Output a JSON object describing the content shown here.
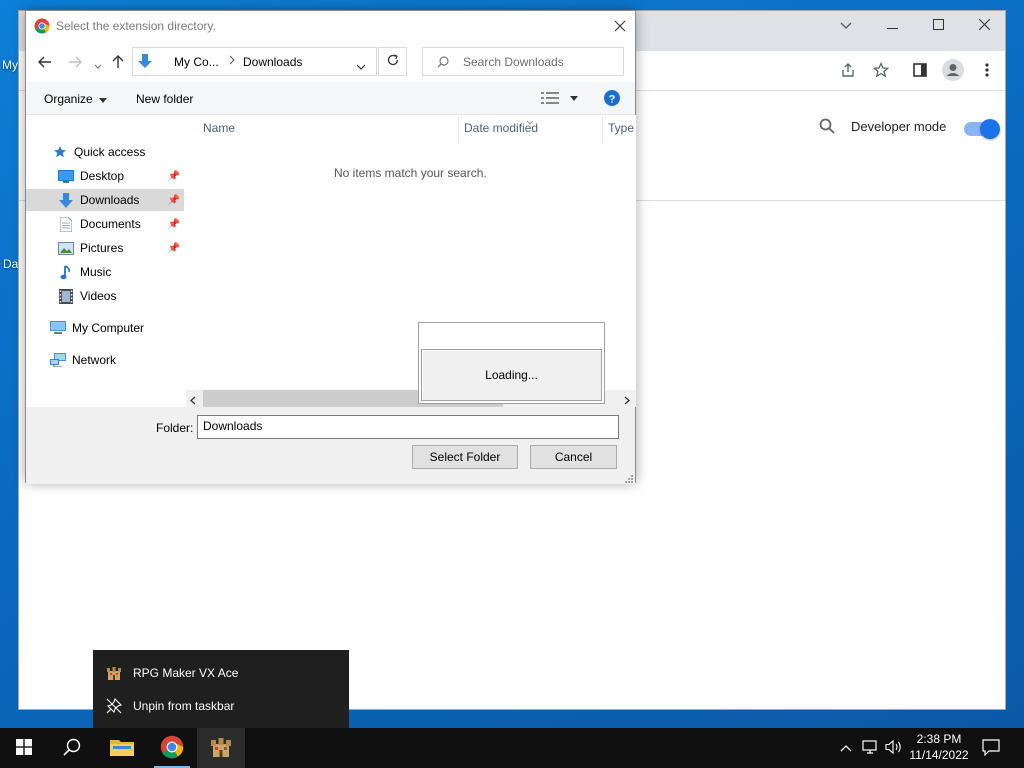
{
  "desktop": {
    "labels": [
      "My",
      "Da"
    ]
  },
  "chrome": {
    "developer_mode_label": "Developer mode",
    "developer_mode_on": true,
    "accent": "#1a73e8"
  },
  "dialog": {
    "title": "Select the extension directory.",
    "address": {
      "crumb1": "My Co...",
      "crumb2": "Downloads"
    },
    "search_placeholder": "Search Downloads",
    "organize_label": "Organize",
    "new_folder_label": "New folder",
    "nav_items": [
      {
        "label": "Quick access"
      },
      {
        "label": "Desktop"
      },
      {
        "label": "Downloads"
      },
      {
        "label": "Documents"
      },
      {
        "label": "Pictures"
      },
      {
        "label": "Music"
      },
      {
        "label": "Videos"
      },
      {
        "label": "My Computer"
      },
      {
        "label": "Network"
      }
    ],
    "columns": {
      "name": "Name",
      "date_modified": "Date modified",
      "type": "Type"
    },
    "empty_message": "No items match your search.",
    "folder_label": "Folder:",
    "folder_value": "Downloads",
    "select_button": "Select Folder",
    "cancel_button": "Cancel"
  },
  "loading": {
    "text": "Loading..."
  },
  "jumplist": {
    "app_name": "RPG Maker VX Ace",
    "unpin_label": "Unpin from taskbar"
  },
  "taskbar": {
    "time": "2:38 PM",
    "date": "11/14/2022"
  }
}
